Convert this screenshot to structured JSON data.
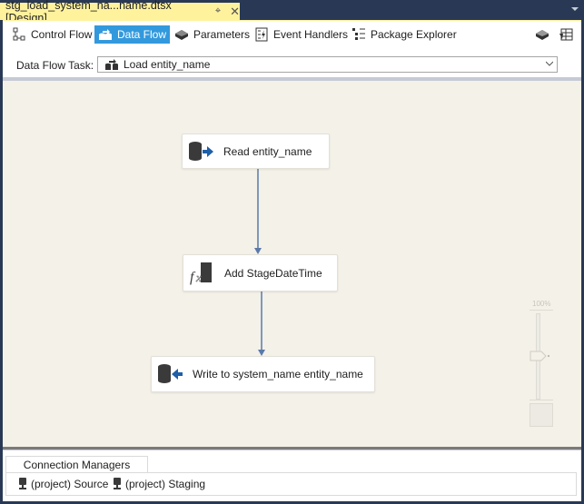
{
  "document_tab": {
    "title": "stg_load_system_na...name.dtsx [Design]",
    "pin_icon": "pin-icon",
    "close_icon": "close-icon"
  },
  "toolbar": {
    "tabs": [
      {
        "label": "Control Flow",
        "icon": "control-flow-icon",
        "active": false
      },
      {
        "label": "Data Flow",
        "icon": "data-flow-icon",
        "active": true
      },
      {
        "label": "Parameters",
        "icon": "parameters-icon",
        "active": false
      },
      {
        "label": "Event Handlers",
        "icon": "event-handlers-icon",
        "active": false
      },
      {
        "label": "Package Explorer",
        "icon": "package-explorer-icon",
        "active": false
      }
    ],
    "right_icons": [
      "variables-icon",
      "toolbox-grid-icon"
    ]
  },
  "task_selector": {
    "label": "Data Flow Task:",
    "value": "Load entity_name",
    "icon": "data-flow-task-icon"
  },
  "canvas": {
    "nodes": [
      {
        "label": "Read entity_name",
        "icon": "source-icon"
      },
      {
        "label": "Add StageDateTime",
        "icon": "derived-column-icon"
      },
      {
        "label": "Write to system_name entity_name",
        "icon": "destination-icon"
      }
    ],
    "zoom": {
      "label": "100%",
      "level_fraction": 0.5
    }
  },
  "connection_managers": {
    "tab_label": "Connection Managers",
    "items": [
      {
        "label": "(project) Source",
        "icon": "connection-icon"
      },
      {
        "label": "(project) Staging",
        "icon": "connection-icon"
      }
    ]
  },
  "colors": {
    "accent": "#3399dd",
    "canvas_bg": "#f4f1e9",
    "tab_yellow": "#fff29d",
    "frame_bg": "#293955",
    "arrow": "#5a7aa8"
  }
}
